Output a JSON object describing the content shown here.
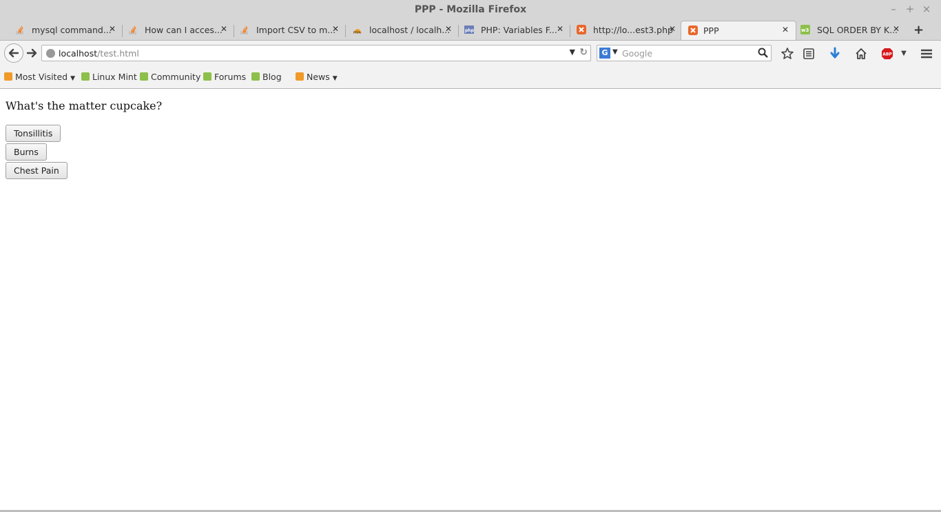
{
  "window": {
    "title": "PPP - Mozilla Firefox",
    "controls": {
      "minimize": "–",
      "maximize": "+",
      "close": "×"
    }
  },
  "tabs": [
    {
      "label": "mysql command...",
      "favicon": "stackoverflow-icon",
      "active": false
    },
    {
      "label": "How can I acces...",
      "favicon": "stackoverflow-icon",
      "active": false
    },
    {
      "label": "Import CSV to m...",
      "favicon": "stackoverflow-icon",
      "active": false
    },
    {
      "label": "localhost / localh...",
      "favicon": "phpmyadmin-icon",
      "active": false
    },
    {
      "label": "PHP: Variables F...",
      "favicon": "php-icon",
      "active": false
    },
    {
      "label": "http://lo...est3.php",
      "favicon": "xampp-icon",
      "active": false
    },
    {
      "label": "PPP",
      "favicon": "xampp-icon",
      "active": true
    },
    {
      "label": "SQL ORDER BY K...",
      "favicon": "w3schools-icon",
      "active": false
    }
  ],
  "newtab_label": "+",
  "navbar": {
    "url_host": "localhost",
    "url_path": "/test.html",
    "search_engine": "G",
    "search_placeholder": "Google"
  },
  "bookmarks": [
    {
      "label": "Most Visited",
      "icon": "most-visited-icon",
      "dropdown": true
    },
    {
      "label": "Linux Mint",
      "icon": "mint-icon",
      "dropdown": false
    },
    {
      "label": "Community",
      "icon": "mint-icon",
      "dropdown": false
    },
    {
      "label": "Forums",
      "icon": "mint-icon",
      "dropdown": false
    },
    {
      "label": "Blog",
      "icon": "mint-icon",
      "dropdown": false
    },
    {
      "label": "News",
      "icon": "rss-icon",
      "dropdown": true
    }
  ],
  "page": {
    "question": "What's the matter cupcake?",
    "buttons": [
      "Tonsillitis",
      "Burns",
      "Chest Pain"
    ]
  },
  "colors": {
    "chrome": "#d6d6d6",
    "toolbar": "#f2f2f2",
    "accent_blue": "#3b7bd4",
    "mint_green": "#8dbf4b",
    "xampp_orange": "#e8672b",
    "abp_red": "#d7191f"
  }
}
